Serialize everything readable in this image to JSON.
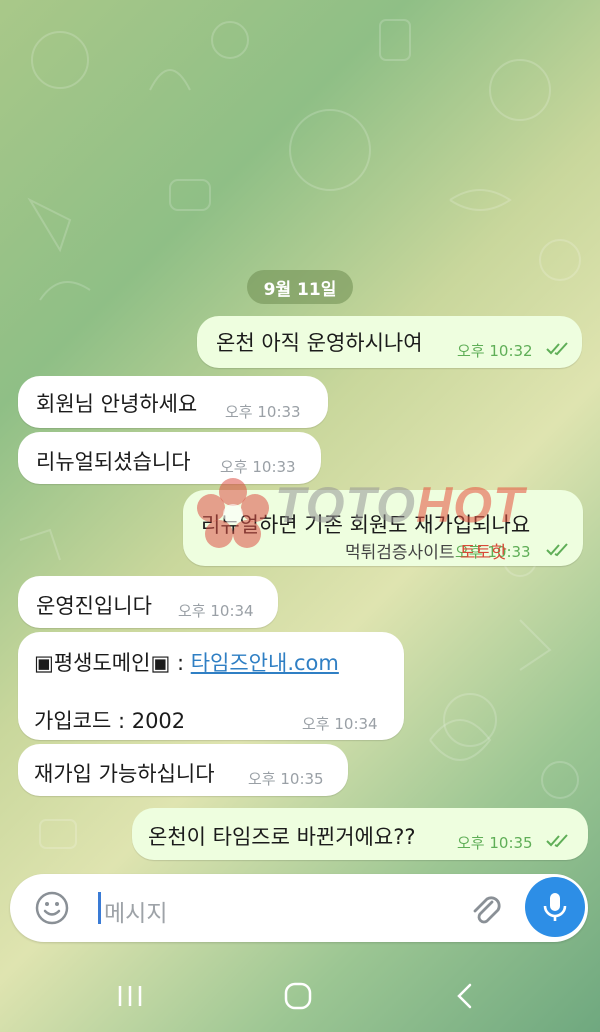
{
  "date_separator": "9월 11일",
  "messages": [
    {
      "direction": "out",
      "text": "온천 아직 운영하시나여",
      "time": "오후 10:32",
      "read": true
    },
    {
      "direction": "in",
      "text": "회원님 안녕하세요",
      "time": "오후 10:33"
    },
    {
      "direction": "in",
      "text": "리뉴얼되셨습니다",
      "time": "오후 10:33"
    },
    {
      "direction": "out",
      "text": "리뉴얼하면 기존 회원도 재가입되나요",
      "time": "오후 10:33",
      "read": true
    },
    {
      "direction": "in",
      "text": "운영진입니다",
      "time": "오후 10:34"
    },
    {
      "direction": "in",
      "line1_prefix": "▣평생도메인▣  : ",
      "line1_link": "타임즈안내.com",
      "line2": "가입코드 : 2002",
      "time": "오후 10:34"
    },
    {
      "direction": "in",
      "text": "재가입 가능하십니다",
      "time": "오후 10:35"
    },
    {
      "direction": "out",
      "text": "온천이 타임즈로 바뀐거에요??",
      "time": "오후 10:35",
      "read": true
    }
  ],
  "watermark": {
    "brand_a": "TOTO",
    "brand_b": "HOT",
    "sub_a": "먹튀검증사이트 ",
    "sub_b": "토토핫"
  },
  "composer": {
    "placeholder": "메시지",
    "emoji_icon": "emoji-smile-icon",
    "attach_icon": "paperclip-icon",
    "mic_icon": "microphone-icon",
    "accent_color": "#2d8ee6"
  },
  "system_nav": {
    "recents_icon": "recents-icon",
    "home_icon": "home-icon",
    "back_icon": "back-icon"
  }
}
